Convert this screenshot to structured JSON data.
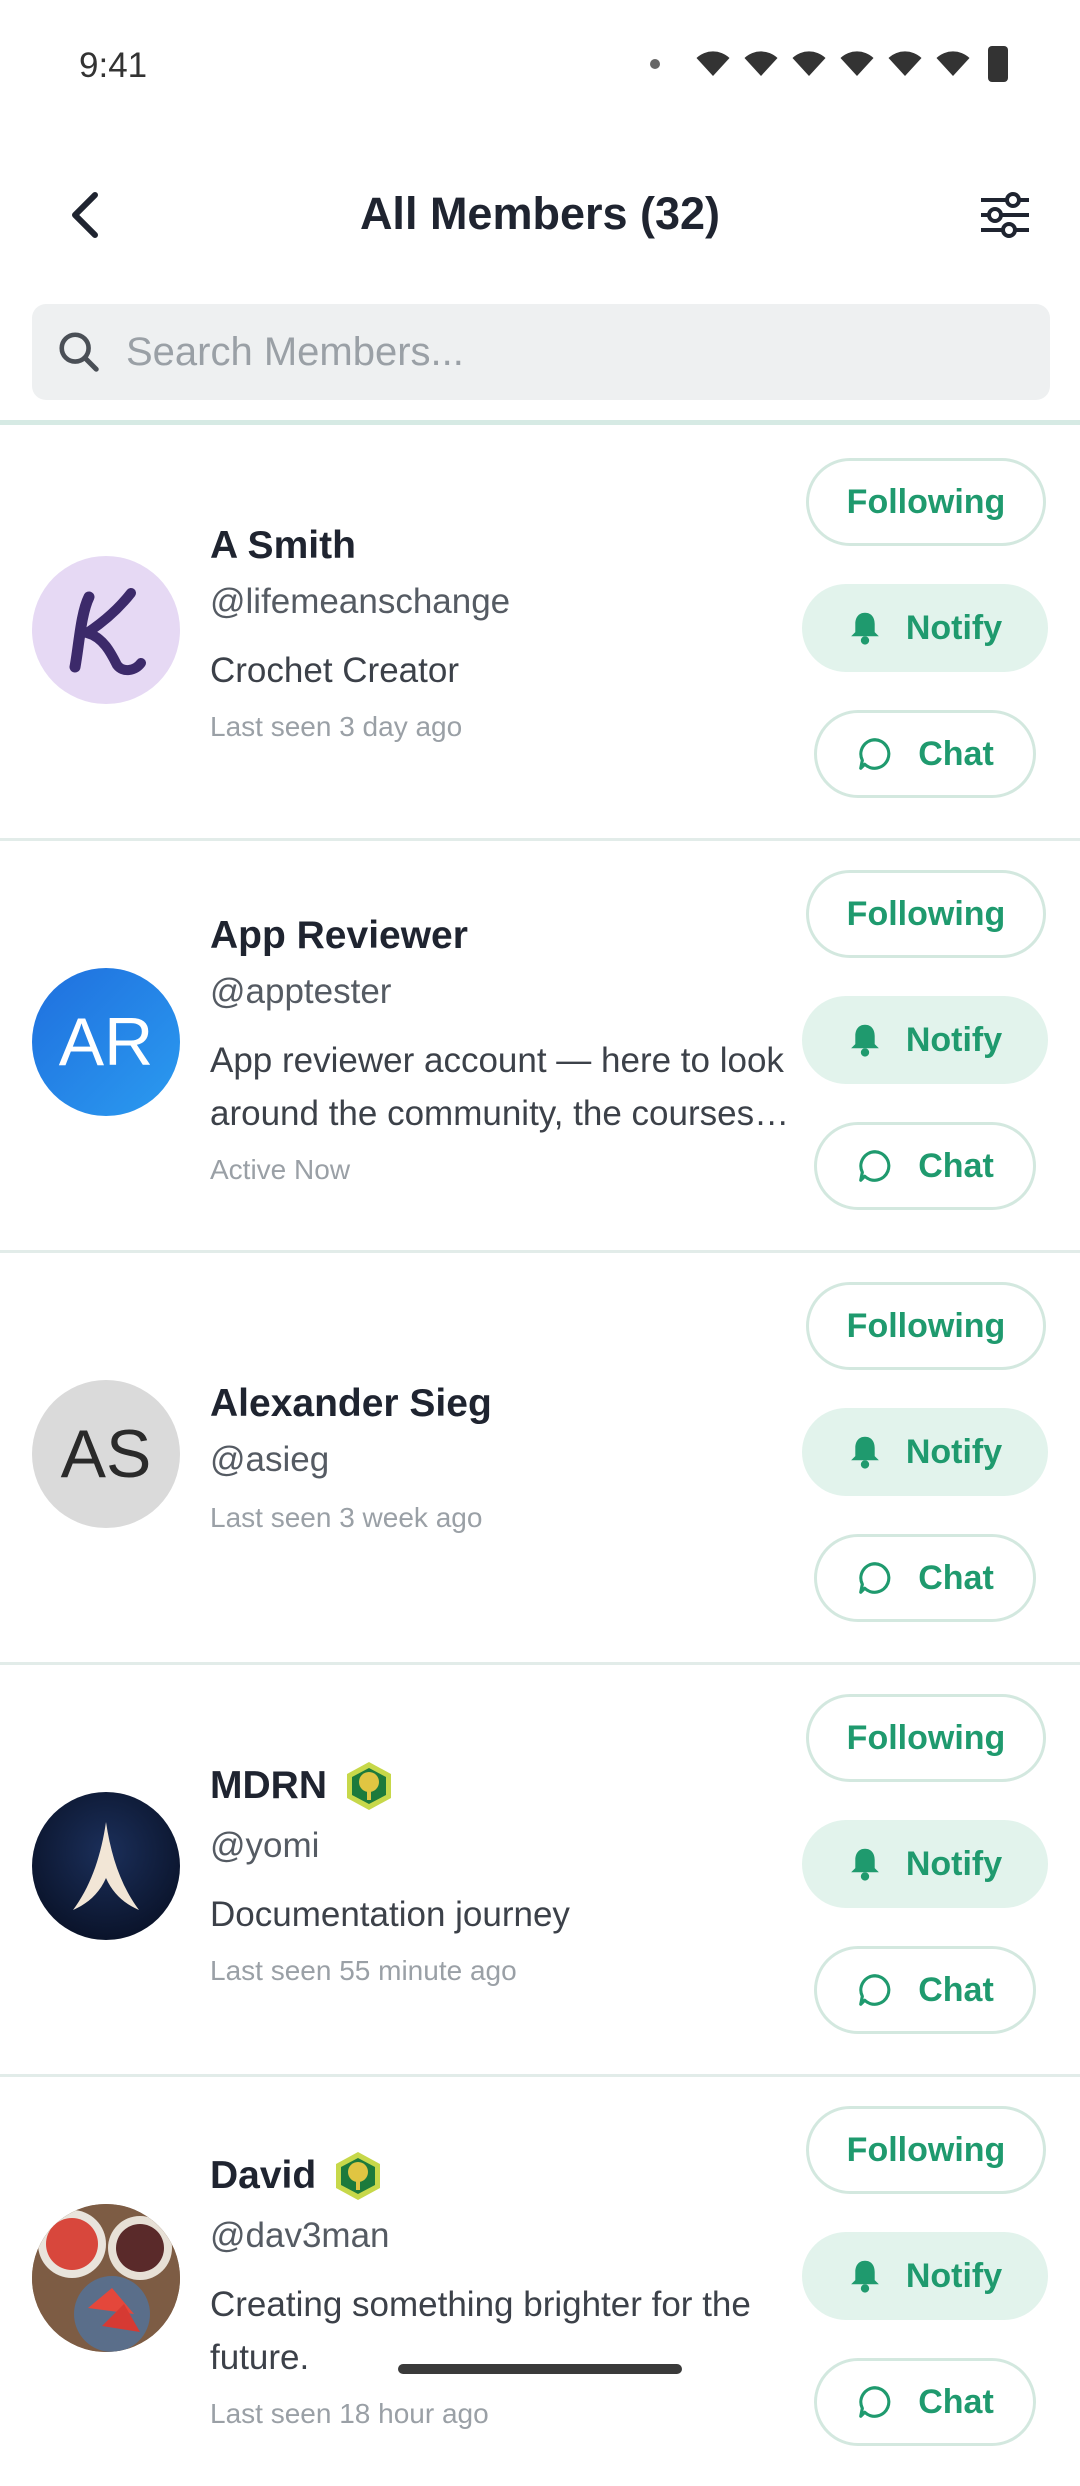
{
  "status_bar": {
    "time": "9:41"
  },
  "header": {
    "title": "All Members (32)"
  },
  "search": {
    "placeholder": "Search Members..."
  },
  "members": [
    {
      "name": "A Smith",
      "handle": "@lifemeanschange",
      "bio": "Crochet Creator",
      "last_seen": "Last seen 3 day ago",
      "avatar": "K",
      "avatar_bg": "#e6d9f4",
      "badge": false
    },
    {
      "name": "App Reviewer",
      "handle": "@apptester",
      "bio": "App reviewer account — here to look around the community, the courses…",
      "last_seen": "Active Now",
      "avatar": "AR",
      "avatar_bg": "#2480e8",
      "badge": false
    },
    {
      "name": "Alexander Sieg",
      "handle": "@asieg",
      "bio": "",
      "last_seen": "Last seen 3 week ago",
      "avatar": "AS",
      "avatar_bg": "#dadada",
      "badge": false
    },
    {
      "name": "MDRN",
      "handle": "@yomi",
      "bio": "Documentation journey",
      "last_seen": "Last seen 55 minute ago",
      "avatar": "",
      "avatar_bg": "#0c1a3a",
      "badge": true
    },
    {
      "name": "David",
      "handle": "@dav3man",
      "bio": "Creating something brighter for the future.",
      "last_seen": "Last seen 18 hour ago",
      "avatar": "",
      "avatar_bg": "#7a5a44",
      "badge": true
    }
  ],
  "actions": {
    "following": "Following",
    "notify": "Notify",
    "chat": "Chat"
  },
  "colors": {
    "accent": "#1f9a6e",
    "accent_bg": "#e2f3ec"
  }
}
